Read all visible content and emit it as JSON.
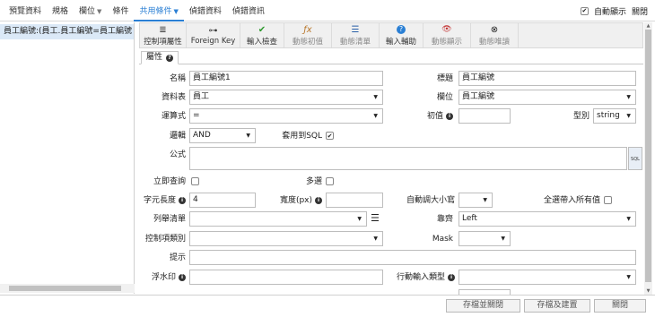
{
  "menu": {
    "items": [
      {
        "label": "預覽資料",
        "dropdown": false,
        "active": false
      },
      {
        "label": "規格",
        "dropdown": false,
        "active": false
      },
      {
        "label": "欄位",
        "dropdown": true,
        "active": false
      },
      {
        "label": "條件",
        "dropdown": false,
        "active": false
      },
      {
        "label": "共用條件",
        "dropdown": true,
        "active": true
      },
      {
        "label": "偵錯資料",
        "dropdown": false,
        "active": false
      },
      {
        "label": "偵錯資訊",
        "dropdown": false,
        "active": false
      }
    ],
    "auto_show_label": "自動顯示",
    "auto_show_checked": true,
    "close_label": "關閉"
  },
  "tree": {
    "selected_node": "員工編號:(員工.員工編號=員工編號"
  },
  "toolbar": {
    "buttons": [
      {
        "label": "控制項屬性",
        "icon": "≣",
        "icon_name": "list-icon",
        "disabled": false
      },
      {
        "label": "Foreign Key",
        "icon": "⊶",
        "icon_name": "foreign-key-icon",
        "disabled": false
      },
      {
        "label": "輸入檢查",
        "icon": "✔",
        "icon_name": "check-icon",
        "disabled": false
      },
      {
        "label": "動態初值",
        "icon": "ƒx",
        "icon_name": "function-icon",
        "disabled": true
      },
      {
        "label": "動態清單",
        "icon": "☰",
        "icon_name": "bullet-list-icon",
        "disabled": true
      },
      {
        "label": "輸入輔助",
        "icon": "?",
        "icon_name": "help-icon",
        "disabled": false
      },
      {
        "label": "動態顯示",
        "icon": "👁",
        "icon_name": "eye-hidden-icon",
        "disabled": true
      },
      {
        "label": "動態唯讀",
        "icon": "⊗",
        "icon_name": "readonly-icon",
        "disabled": true
      }
    ]
  },
  "tab": {
    "label": "屬性"
  },
  "form": {
    "name_label": "名稱",
    "name_value": "員工編號1",
    "title_label": "標題",
    "title_value": "員工編號",
    "table_label": "資料表",
    "table_value": "員工",
    "field_label": "欄位",
    "field_value": "員工編號",
    "operator_label": "運算式",
    "operator_value": "=",
    "initial_label": "初值",
    "initial_value": "",
    "type_label": "型別",
    "type_value": "string",
    "logic_label": "邏輯",
    "logic_value": "AND",
    "sql_label": "套用到SQL",
    "sql_checked": true,
    "formula_label": "公式",
    "formula_value": "",
    "formula_button": "SQL",
    "instant_label": "立即查詢",
    "instant_checked": false,
    "multi_label": "多選",
    "multi_checked": false,
    "length_label": "字元長度",
    "length_value": "4",
    "width_label": "寬度(px)",
    "width_value": "",
    "autosize_label": "自動調大小寫",
    "autosize_value": "",
    "allowall_label": "全選帶入所有值",
    "allowall_checked": false,
    "listing_label": "列舉清單",
    "listing_value": "",
    "align_label": "靠齊",
    "align_value": "Left",
    "control_label": "控制項類別",
    "control_value": "",
    "mask_label": "Mask",
    "mask_value": "",
    "hint_label": "提示",
    "hint_value": "",
    "watermark_label": "浮水印",
    "watermark_value": "",
    "mobile_label": "行動輸入類型",
    "mobile_value": ""
  },
  "footer": {
    "save_close": "存檔並關閉",
    "save_rebuild": "存檔及建置",
    "close": "關閉"
  },
  "colors": {
    "accent": "#2a7fd4",
    "selection": "#dbe9f7",
    "toolbar_bg": "#f0f0f0"
  }
}
